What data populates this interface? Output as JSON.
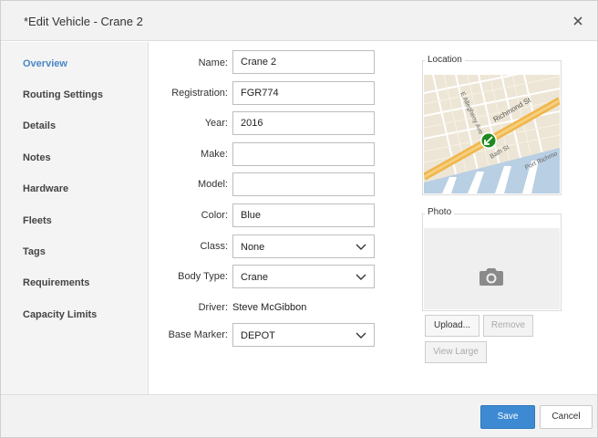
{
  "dialog": {
    "title": "*Edit Vehicle - Crane 2"
  },
  "sidebar": {
    "items": [
      {
        "label": "Overview",
        "active": true
      },
      {
        "label": "Routing Settings"
      },
      {
        "label": "Details"
      },
      {
        "label": "Notes"
      },
      {
        "label": "Hardware"
      },
      {
        "label": "Fleets"
      },
      {
        "label": "Tags"
      },
      {
        "label": "Requirements"
      },
      {
        "label": "Capacity Limits"
      }
    ]
  },
  "form": {
    "name": {
      "label": "Name:",
      "value": "Crane 2"
    },
    "registration": {
      "label": "Registration:",
      "value": "FGR774"
    },
    "year": {
      "label": "Year:",
      "value": "2016"
    },
    "make": {
      "label": "Make:",
      "value": ""
    },
    "model": {
      "label": "Model:",
      "value": ""
    },
    "color": {
      "label": "Color:",
      "value": "Blue"
    },
    "class": {
      "label": "Class:",
      "value": "None"
    },
    "body_type": {
      "label": "Body Type:",
      "value": "Crane"
    },
    "driver": {
      "label": "Driver:",
      "value": "Steve McGibbon"
    },
    "base_marker": {
      "label": "Base Marker:",
      "value": "DEPOT"
    }
  },
  "location": {
    "title": "Location",
    "map_labels": {
      "street1": "Richmond St",
      "street2": "E Allegheny Ave",
      "street3": "Bath St",
      "street4": "Port Richmo"
    }
  },
  "photo": {
    "title": "Photo",
    "upload_label": "Upload...",
    "remove_label": "Remove",
    "view_large_label": "View Large"
  },
  "footer": {
    "save_label": "Save",
    "cancel_label": "Cancel"
  },
  "colors": {
    "accent": "#3d8ad2",
    "active_nav": "#4a86c6",
    "marker": "#1f8a1f"
  }
}
